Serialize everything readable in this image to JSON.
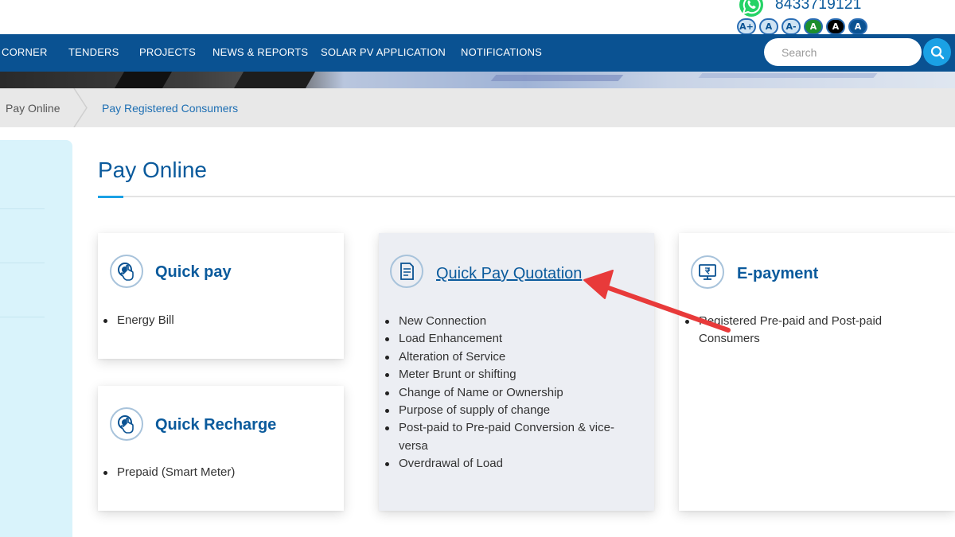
{
  "topbar": {
    "whatsapp_icon": "whatsapp-icon",
    "phone": "8433719121",
    "font_controls": [
      {
        "label": "A+",
        "bg": "#cfe3f3",
        "fg": "#0a5292"
      },
      {
        "label": "A",
        "bg": "#cfe3f3",
        "fg": "#0a5292"
      },
      {
        "label": "A-",
        "bg": "#cfe3f3",
        "fg": "#0a5292"
      },
      {
        "label": "A",
        "bg": "#1b8e2d",
        "fg": "#ffffff"
      },
      {
        "label": "A",
        "bg": "#000000",
        "fg": "#ffffff"
      },
      {
        "label": "A",
        "bg": "#0a5292",
        "fg": "#ffffff"
      }
    ]
  },
  "nav": {
    "items": [
      "CORNER",
      "TENDERS",
      "PROJECTS",
      "NEWS & REPORTS",
      "SOLAR PV APPLICATION",
      "NOTIFICATIONS"
    ],
    "search_placeholder": "Search",
    "search_icon": "search-icon"
  },
  "breadcrumb": {
    "items": [
      "Pay Online",
      "Pay Registered Consumers"
    ]
  },
  "page": {
    "title": "Pay Online"
  },
  "cards": {
    "quick_pay": {
      "icon": "hand-pointer-icon",
      "title": "Quick pay",
      "items": [
        "Energy Bill"
      ]
    },
    "quick_recharge": {
      "icon": "hand-pointer-icon",
      "title": "Quick Recharge",
      "items": [
        "Prepaid (Smart Meter)"
      ]
    },
    "quick_pay_quotation": {
      "icon": "document-icon",
      "title": "Quick Pay Quotation",
      "items": [
        "New Connection",
        "Load Enhancement",
        "Alteration of Service",
        "Meter Brunt or shifting",
        "Change of Name or Ownership",
        "Purpose of supply of change",
        "Post-paid to Pre-paid Conversion & vice-versa",
        "Overdrawal of Load"
      ]
    },
    "e_payment": {
      "icon": "monitor-rupee-icon",
      "title": "E-payment",
      "items": [
        "Registered Pre-paid and Post-paid Consumers"
      ]
    }
  },
  "annotation": {
    "arrow_color": "#e83a3a"
  },
  "colors": {
    "nav_bg": "#0a5292",
    "accent": "#1aa1e5",
    "heading": "#0a5a9c"
  }
}
